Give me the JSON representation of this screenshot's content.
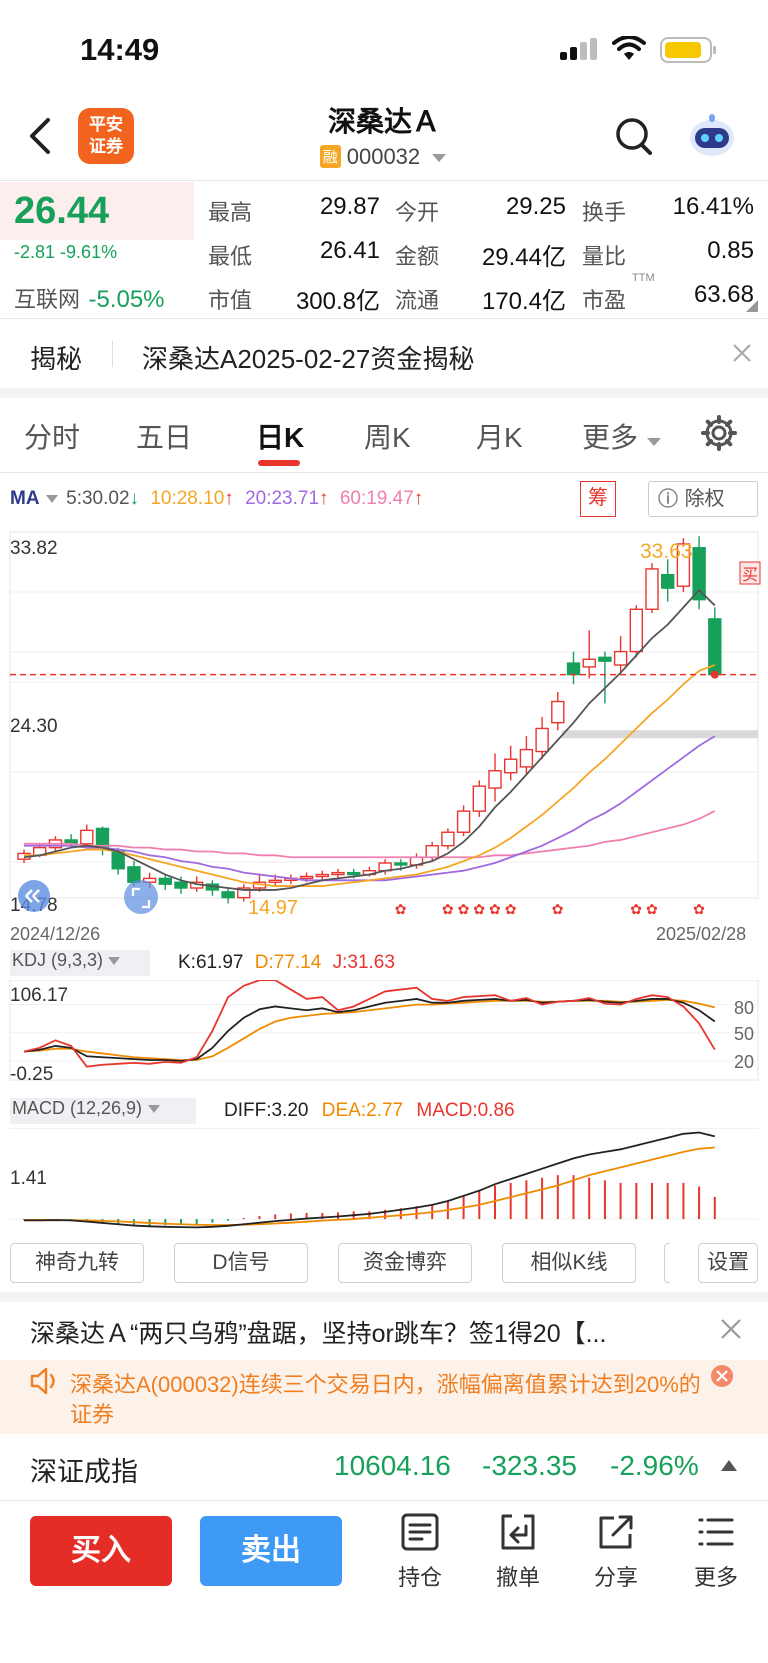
{
  "status": {
    "time": "14:49"
  },
  "header": {
    "logo_line1": "平安",
    "logo_line2": "证券",
    "title": "深桑达Ａ",
    "badge": "融",
    "code": "000032"
  },
  "quote": {
    "price": "26.44",
    "change": "-2.81",
    "change_pct": "-9.61%",
    "sector_name": "互联网",
    "sector_change": "-5.05%",
    "fields": [
      {
        "label": "最高",
        "value": "29.87"
      },
      {
        "label": "今开",
        "value": "29.25"
      },
      {
        "label": "换手",
        "value": "16.41%"
      },
      {
        "label": "最低",
        "value": "26.41"
      },
      {
        "label": "金额",
        "value": "29.44亿"
      },
      {
        "label": "量比",
        "value": "0.85"
      },
      {
        "label": "市值",
        "value": "300.8亿"
      },
      {
        "label": "流通",
        "value": "170.4亿"
      },
      {
        "label": "市盈",
        "value": "63.68"
      }
    ],
    "pe_suffix": "TTM"
  },
  "reveal": {
    "tag": "揭秘",
    "text": "深桑达A2025-02-27资金揭秘"
  },
  "tabs": [
    "分时",
    "五日",
    "日K",
    "周K",
    "月K",
    "更多"
  ],
  "ma": {
    "label": "MA",
    "items": [
      {
        "text": "5:30.02",
        "color": "#555555"
      },
      {
        "text": "10:28.10",
        "color": "#f5a623"
      },
      {
        "text": "20:23.71",
        "color": "#a06ae0"
      },
      {
        "text": "60:19.47",
        "color": "#f07fb0"
      }
    ],
    "chip_label": "筹",
    "exright_label": "除权"
  },
  "kline": {
    "y_top": "33.82",
    "y_mid": "24.30",
    "y_bot": "14.78",
    "high_label": "33.63",
    "low_label": "14.97",
    "date_start": "2024/12/26",
    "date_end": "2025/02/28",
    "buy_mark": "买",
    "candles": [
      [
        16.8,
        17.1,
        16.6,
        17.3
      ],
      [
        17.0,
        17.4,
        16.9,
        17.6
      ],
      [
        17.4,
        17.8,
        17.2,
        18.0
      ],
      [
        17.8,
        17.6,
        17.4,
        18.1
      ],
      [
        17.6,
        18.3,
        17.4,
        18.6
      ],
      [
        18.4,
        17.4,
        17.0,
        18.5
      ],
      [
        17.2,
        16.3,
        16.0,
        17.4
      ],
      [
        16.4,
        15.6,
        15.4,
        16.7
      ],
      [
        15.6,
        15.8,
        15.3,
        16.1
      ],
      [
        15.8,
        15.5,
        15.2,
        16.0
      ],
      [
        15.6,
        15.3,
        15.0,
        15.9
      ],
      [
        15.3,
        15.6,
        15.1,
        15.9
      ],
      [
        15.5,
        15.2,
        14.9,
        15.7
      ],
      [
        15.1,
        14.8,
        14.5,
        15.3
      ],
      [
        14.8,
        15.3,
        14.6,
        15.5
      ],
      [
        15.3,
        15.6,
        15.1,
        16.0
      ],
      [
        15.6,
        15.7,
        15.4,
        16.0
      ],
      [
        15.7,
        15.8,
        15.5,
        16.0
      ],
      [
        15.8,
        15.9,
        15.6,
        16.1
      ],
      [
        15.9,
        16.0,
        15.7,
        16.2
      ],
      [
        16.0,
        16.1,
        15.8,
        16.3
      ],
      [
        16.1,
        16.0,
        15.8,
        16.3
      ],
      [
        16.0,
        16.2,
        15.9,
        16.4
      ],
      [
        16.2,
        16.6,
        16.0,
        16.8
      ],
      [
        16.6,
        16.5,
        16.2,
        16.8
      ],
      [
        16.5,
        16.9,
        16.3,
        17.1
      ],
      [
        16.9,
        17.5,
        16.7,
        17.7
      ],
      [
        17.5,
        18.2,
        17.3,
        18.4
      ],
      [
        18.2,
        19.3,
        18.0,
        19.6
      ],
      [
        19.3,
        20.6,
        19.0,
        20.9
      ],
      [
        20.5,
        21.4,
        19.8,
        22.3
      ],
      [
        21.3,
        22.0,
        20.9,
        22.7
      ],
      [
        21.6,
        22.5,
        21.2,
        23.2
      ],
      [
        22.4,
        23.6,
        22.0,
        24.2
      ],
      [
        23.9,
        25.0,
        23.5,
        25.5
      ],
      [
        27.0,
        26.4,
        25.9,
        27.6
      ],
      [
        26.8,
        27.2,
        26.2,
        28.7
      ],
      [
        27.3,
        27.1,
        24.9,
        27.6
      ],
      [
        26.9,
        27.6,
        26.5,
        28.4
      ],
      [
        27.6,
        29.8,
        27.3,
        30.0
      ],
      [
        29.8,
        31.9,
        29.6,
        32.2
      ],
      [
        31.6,
        30.9,
        30.2,
        32.4
      ],
      [
        31.0,
        33.2,
        30.7,
        33.5
      ],
      [
        33.0,
        30.3,
        29.8,
        33.6
      ],
      [
        29.3,
        26.4,
        26.3,
        29.9
      ]
    ],
    "ma5": [
      16.9,
      17.0,
      17.2,
      17.4,
      17.5,
      17.4,
      17.2,
      16.8,
      16.4,
      16.0,
      15.7,
      15.5,
      15.4,
      15.3,
      15.2,
      15.2,
      15.2,
      15.3,
      15.5,
      15.7,
      15.8,
      15.9,
      16.0,
      16.2,
      16.3,
      16.5,
      16.7,
      17.1,
      17.7,
      18.5,
      19.5,
      20.3,
      21.2,
      22.1,
      23.0,
      23.9,
      24.9,
      25.7,
      26.5,
      27.4,
      28.3,
      29.0,
      29.9,
      30.8,
      30.0
    ],
    "ma10": [
      17.0,
      17.0,
      17.1,
      17.2,
      17.3,
      17.3,
      17.2,
      17.0,
      16.8,
      16.6,
      16.4,
      16.2,
      16.0,
      15.8,
      15.6,
      15.5,
      15.4,
      15.4,
      15.4,
      15.4,
      15.5,
      15.6,
      15.7,
      15.8,
      15.9,
      16.0,
      16.2,
      16.4,
      16.7,
      17.0,
      17.4,
      17.9,
      18.5,
      19.1,
      19.8,
      20.5,
      21.3,
      22.0,
      22.8,
      23.6,
      24.4,
      25.1,
      25.9,
      26.6,
      26.9
    ],
    "ma20": [
      17.5,
      17.5,
      17.5,
      17.5,
      17.4,
      17.4,
      17.3,
      17.2,
      17.0,
      16.9,
      16.7,
      16.6,
      16.4,
      16.3,
      16.1,
      16.0,
      15.9,
      15.8,
      15.7,
      15.7,
      15.7,
      15.7,
      15.7,
      15.7,
      15.8,
      15.9,
      16.0,
      16.1,
      16.2,
      16.4,
      16.6,
      16.9,
      17.2,
      17.5,
      17.9,
      18.3,
      18.8,
      19.2,
      19.7,
      20.3,
      20.9,
      21.5,
      22.1,
      22.7,
      23.2
    ],
    "ma60": [
      17.6,
      17.6,
      17.6,
      17.6,
      17.5,
      17.5,
      17.5,
      17.4,
      17.4,
      17.3,
      17.3,
      17.2,
      17.2,
      17.1,
      17.1,
      17.0,
      17.0,
      16.9,
      16.9,
      16.9,
      16.9,
      16.9,
      16.9,
      16.9,
      16.9,
      16.9,
      16.9,
      16.9,
      16.9,
      16.9,
      17.0,
      17.0,
      17.1,
      17.2,
      17.3,
      17.4,
      17.5,
      17.7,
      17.8,
      18.0,
      18.2,
      18.4,
      18.6,
      18.9,
      19.3
    ]
  },
  "kdj": {
    "label": "KDJ (9,3,3)",
    "k_text": "K:61.97",
    "d_text": "D:77.14",
    "j_text": "J:31.63",
    "y_top": "106.17",
    "y_bot": "-0.25",
    "levels": [
      "80",
      "50",
      "20"
    ],
    "k": [
      30,
      32,
      36,
      34,
      25,
      24,
      23,
      22,
      21,
      21,
      20,
      22,
      34,
      52,
      66,
      75,
      78,
      76,
      74,
      76,
      72,
      74,
      78,
      82,
      84,
      86,
      82,
      82,
      84,
      85,
      86,
      84,
      85,
      82,
      83,
      84,
      85,
      83,
      82,
      84,
      86,
      86,
      82,
      74,
      62
    ],
    "d": [
      30,
      31,
      33,
      33,
      30,
      28,
      26,
      24,
      23,
      22,
      21,
      21,
      25,
      34,
      44,
      54,
      62,
      66,
      68,
      70,
      71,
      72,
      74,
      76,
      78,
      80,
      80,
      81,
      82,
      83,
      84,
      84,
      84,
      83,
      83,
      84,
      84,
      84,
      83,
      83,
      84,
      85,
      84,
      81,
      77
    ],
    "j": [
      30,
      34,
      42,
      36,
      14,
      16,
      17,
      18,
      17,
      19,
      18,
      24,
      52,
      88,
      100,
      106,
      106,
      96,
      86,
      88,
      74,
      78,
      86,
      94,
      96,
      98,
      86,
      84,
      88,
      89,
      90,
      84,
      87,
      80,
      83,
      84,
      87,
      81,
      80,
      86,
      90,
      88,
      78,
      60,
      32
    ]
  },
  "macd": {
    "label": "MACD (12,26,9)",
    "diff_text": "DIFF:3.20",
    "dea_text": "DEA:2.77",
    "macd_text": "MACD:0.86",
    "y_top": "1.41",
    "diff": [
      -0.05,
      -0.05,
      -0.04,
      -0.05,
      -0.1,
      -0.15,
      -0.2,
      -0.25,
      -0.28,
      -0.3,
      -0.31,
      -0.32,
      -0.3,
      -0.26,
      -0.2,
      -0.14,
      -0.08,
      -0.03,
      0.02,
      0.06,
      0.1,
      0.15,
      0.2,
      0.28,
      0.36,
      0.45,
      0.55,
      0.7,
      0.9,
      1.1,
      1.35,
      1.55,
      1.75,
      1.95,
      2.15,
      2.35,
      2.5,
      2.6,
      2.7,
      2.85,
      3.0,
      3.15,
      3.3,
      3.35,
      3.2
    ],
    "dea": [
      -0.03,
      -0.03,
      -0.03,
      -0.04,
      -0.05,
      -0.07,
      -0.09,
      -0.12,
      -0.15,
      -0.18,
      -0.2,
      -0.22,
      -0.23,
      -0.23,
      -0.22,
      -0.2,
      -0.17,
      -0.14,
      -0.1,
      -0.06,
      -0.03,
      0.0,
      0.05,
      0.1,
      0.15,
      0.2,
      0.27,
      0.35,
      0.45,
      0.55,
      0.7,
      0.85,
      1.0,
      1.15,
      1.3,
      1.5,
      1.7,
      1.85,
      2.0,
      2.15,
      2.3,
      2.45,
      2.6,
      2.72,
      2.77
    ],
    "hist": [
      -0.04,
      -0.04,
      -0.02,
      -0.02,
      -0.1,
      -0.16,
      -0.22,
      -0.26,
      -0.26,
      -0.24,
      -0.22,
      -0.2,
      -0.14,
      -0.06,
      0.04,
      0.12,
      0.18,
      0.22,
      0.24,
      0.24,
      0.26,
      0.3,
      0.3,
      0.36,
      0.42,
      0.5,
      0.56,
      0.7,
      0.9,
      1.1,
      1.3,
      1.4,
      1.5,
      1.6,
      1.7,
      1.7,
      1.6,
      1.5,
      1.4,
      1.4,
      1.4,
      1.4,
      1.4,
      1.26,
      0.86
    ]
  },
  "tools": [
    "神奇九转",
    "D信号",
    "资金博弈",
    "相似K线",
    "设置"
  ],
  "news": {
    "text": "深桑达Ａ“两只乌鸦”盘踞，坚持or跳车？签1得20【..."
  },
  "alert": {
    "text": "深桑达A(000032)连续三个交易日内，涨幅偏离值累计达到20%的证券",
    "color": "#f07e22"
  },
  "index": {
    "name": "深证成指",
    "value": "10604.16",
    "change": "-323.35",
    "pct": "-2.96%"
  },
  "actions": {
    "buy": "买入",
    "sell": "卖出",
    "nav": [
      "持仓",
      "撤单",
      "分享",
      "更多"
    ]
  }
}
